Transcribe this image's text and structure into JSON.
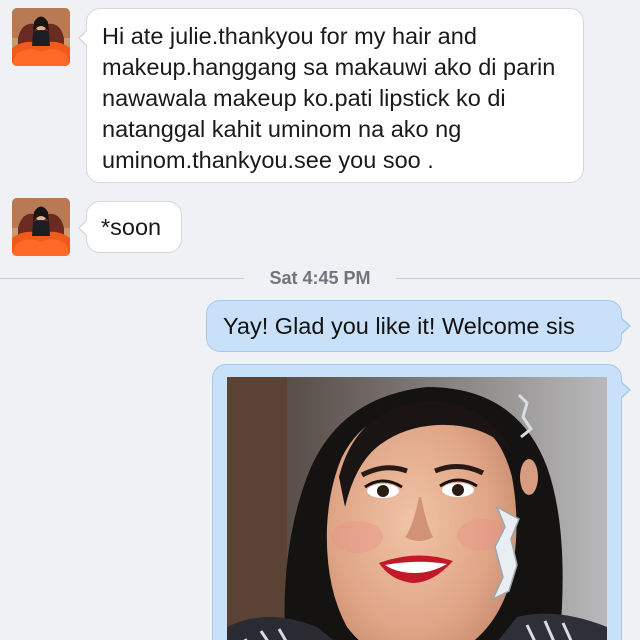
{
  "conversation": {
    "messages": [
      {
        "direction": "incoming",
        "avatar": "sender-avatar",
        "text": "Hi ate julie.thankyou for my hair and makeup.hanggang sa makauwi ako di parin nawawala makeup ko.pati lipstick ko di natanggal kahit uminom na ako ng uminom.thankyou.see you soo ."
      },
      {
        "direction": "incoming",
        "avatar": "sender-avatar",
        "text": "*soon"
      },
      {
        "direction": "outgoing",
        "text": "Yay! Glad you like it! Welcome sis"
      },
      {
        "direction": "outgoing",
        "attachment": "photo"
      }
    ],
    "timestamp": "Sat 4:45 PM"
  },
  "colors": {
    "background": "#f0f1f4",
    "incoming_bubble": "#ffffff",
    "outgoing_bubble": "#c9e1f8",
    "timestamp_text": "#70747c"
  }
}
